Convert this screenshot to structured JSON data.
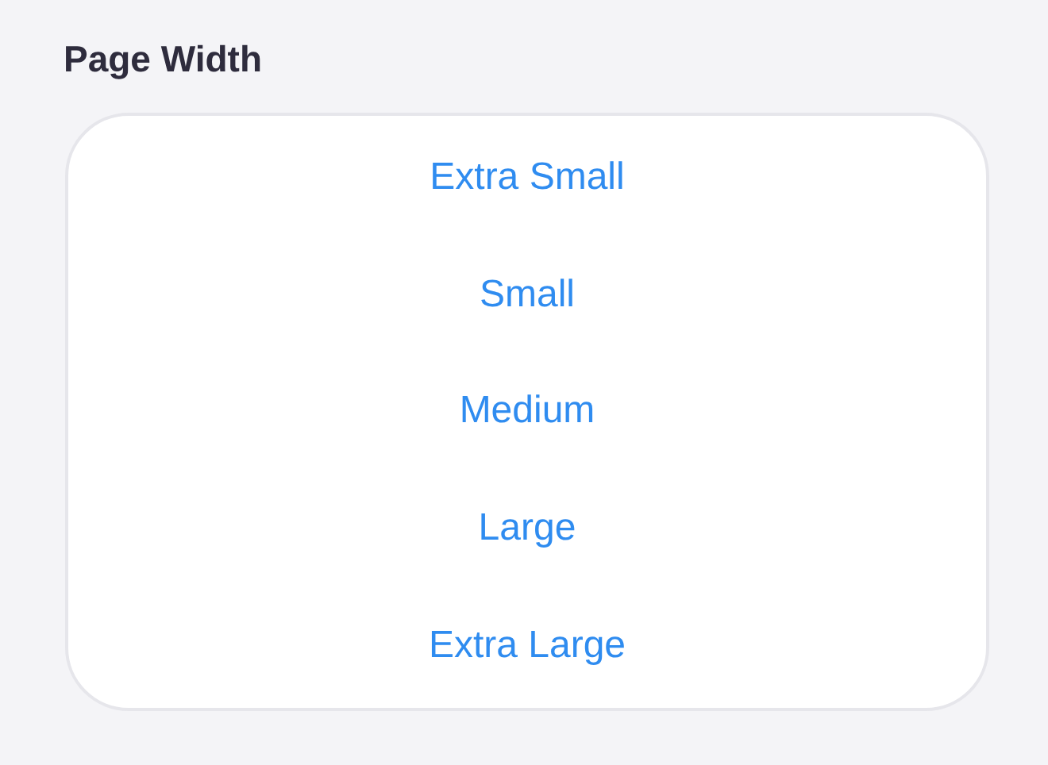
{
  "section": {
    "title": "Page Width"
  },
  "options": [
    {
      "label": "Extra Small"
    },
    {
      "label": "Small"
    },
    {
      "label": "Medium"
    },
    {
      "label": "Large"
    },
    {
      "label": "Extra Large"
    }
  ]
}
